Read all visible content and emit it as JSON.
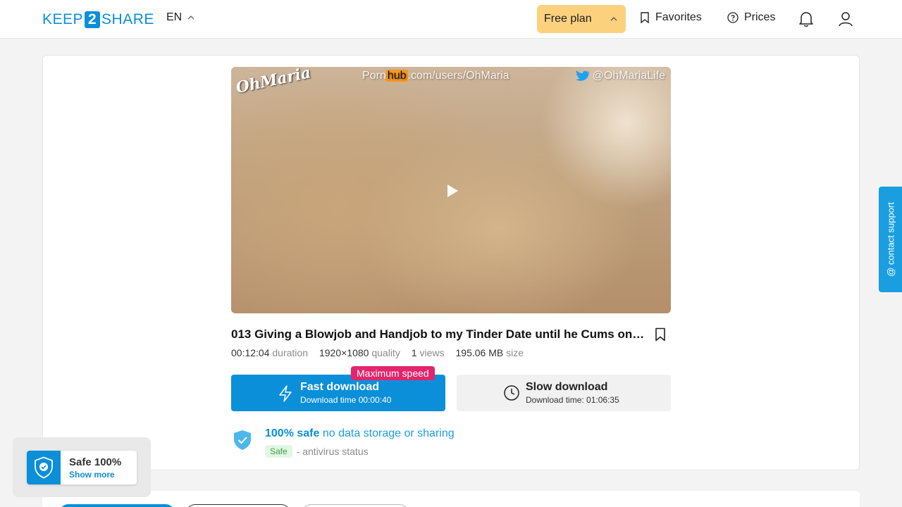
{
  "header": {
    "logo_left": "KEEP",
    "logo_num": "2",
    "logo_right": "SHARE",
    "lang": "EN",
    "plan_label": "Free plan",
    "favorites_label": "Favorites",
    "prices_label": "Prices"
  },
  "video": {
    "watermark_left": "OhMaria",
    "watermark_center_pre": "Porn",
    "watermark_center_hub": "hub",
    "watermark_center_post": ".com/users/OhMaria",
    "watermark_right": "@OhMariaLife"
  },
  "file": {
    "title": "013 Giving a Blowjob and Handjob to my Tinder Date until he Cums on my Tit...",
    "duration_value": "00:12:04",
    "duration_label": "duration",
    "quality_value": "1920×1080",
    "quality_label": "quality",
    "views_value": "1",
    "views_label": "views",
    "size_value": "195.06 MB",
    "size_label": "size"
  },
  "download": {
    "badge": "Maximum speed",
    "fast_label": "Fast download",
    "fast_time": "Download time 00:00:40",
    "slow_label": "Slow download",
    "slow_time": "Download time: 01:06:35"
  },
  "safety": {
    "headline_bold": "100% safe",
    "headline_rest": "no data storage or sharing",
    "tag": "Safe",
    "status_text": "- antivirus status"
  },
  "contact": {
    "label": "@ contact support"
  },
  "safe_widget": {
    "title": "Safe 100%",
    "link": "Show more"
  },
  "colors": {
    "accent": "#0a8fd8",
    "plan_bg": "#fcd17e",
    "badge": "#e3256b",
    "safe_tag_bg": "#e2f6e4"
  }
}
